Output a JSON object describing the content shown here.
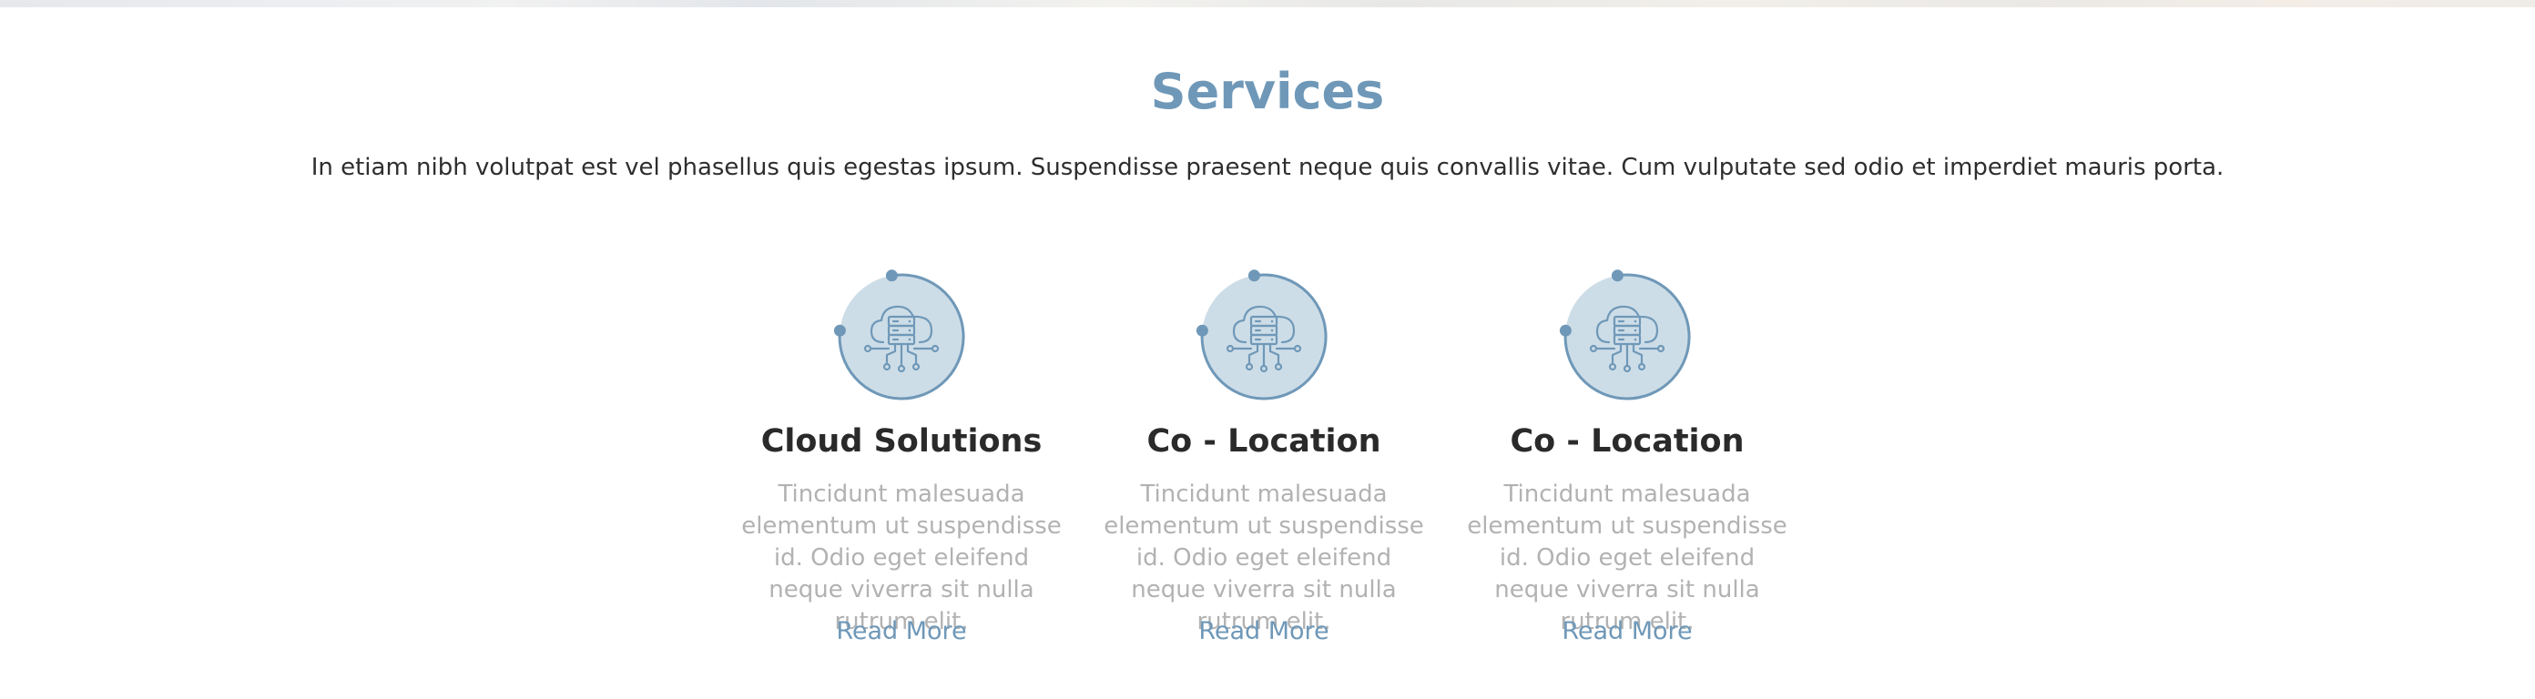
{
  "services": {
    "title": "Services",
    "intro": "In etiam nibh volutpat est vel phasellus quis egestas ipsum. Suspendisse praesent neque quis convallis vitae. Cum vulputate sed odio et imperdiet mauris porta.",
    "cards": [
      {
        "icon": "cloud-server-icon",
        "title": "Cloud Solutions",
        "description": "Tincidunt malesuada elementum ut suspendisse id. Odio eget eleifend neque viverra sit nulla rutrum elit.",
        "link": "Read More"
      },
      {
        "icon": "cloud-server-icon",
        "title": "Co - Location",
        "description": "Tincidunt malesuada elementum ut suspendisse id. Odio eget eleifend neque viverra sit nulla rutrum elit.",
        "link": "Read More"
      },
      {
        "icon": "cloud-server-icon",
        "title": "Co - Location",
        "description": "Tincidunt malesuada elementum ut suspendisse id. Odio eget eleifend neque viverra sit nulla rutrum elit.",
        "link": "Read More"
      }
    ]
  },
  "colors": {
    "accent": "#6f98b8",
    "icon_fill": "#cddde7",
    "heading": "#2a2a2a",
    "muted": "#b2b2b2"
  }
}
